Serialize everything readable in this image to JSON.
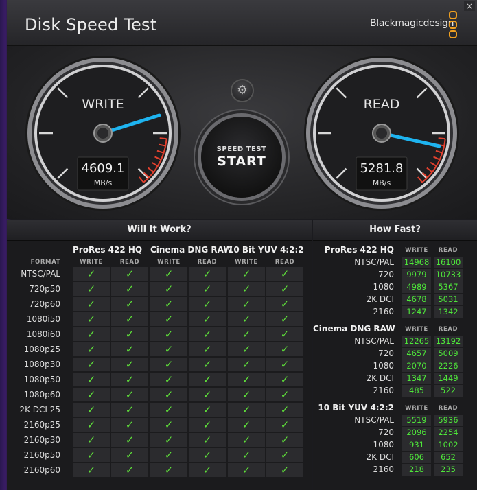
{
  "window": {
    "title": "Disk Speed Test",
    "brand": "Blackmagicdesign",
    "close_glyph": "×"
  },
  "gauges": {
    "write": {
      "label": "WRITE",
      "value": "4609.1",
      "unit": "MB/s",
      "needle_value": 4609.1
    },
    "read": {
      "label": "READ",
      "value": "5281.8",
      "unit": "MB/s",
      "needle_value": 5281.8
    }
  },
  "controls": {
    "settings_icon": "gear-icon",
    "start_sub": "SPEED TEST",
    "start_main": "START"
  },
  "will_it_work": {
    "title": "Will It Work?",
    "format_header": "FORMAT",
    "groups": [
      {
        "name": "ProRes 422 HQ",
        "cols": [
          "WRITE",
          "READ"
        ]
      },
      {
        "name": "Cinema DNG RAW",
        "cols": [
          "WRITE",
          "READ"
        ]
      },
      {
        "name": "10 Bit YUV 4:2:2",
        "cols": [
          "WRITE",
          "READ"
        ]
      }
    ],
    "check_glyph": "✓",
    "rows": [
      {
        "format": "NTSC/PAL",
        "checks": [
          true,
          true,
          true,
          true,
          true,
          true
        ]
      },
      {
        "format": "720p50",
        "checks": [
          true,
          true,
          true,
          true,
          true,
          true
        ]
      },
      {
        "format": "720p60",
        "checks": [
          true,
          true,
          true,
          true,
          true,
          true
        ]
      },
      {
        "format": "1080i50",
        "checks": [
          true,
          true,
          true,
          true,
          true,
          true
        ]
      },
      {
        "format": "1080i60",
        "checks": [
          true,
          true,
          true,
          true,
          true,
          true
        ]
      },
      {
        "format": "1080p25",
        "checks": [
          true,
          true,
          true,
          true,
          true,
          true
        ]
      },
      {
        "format": "1080p30",
        "checks": [
          true,
          true,
          true,
          true,
          true,
          true
        ]
      },
      {
        "format": "1080p50",
        "checks": [
          true,
          true,
          true,
          true,
          true,
          true
        ]
      },
      {
        "format": "1080p60",
        "checks": [
          true,
          true,
          true,
          true,
          true,
          true
        ]
      },
      {
        "format": "2K DCI 25",
        "checks": [
          true,
          true,
          true,
          true,
          true,
          true
        ]
      },
      {
        "format": "2160p25",
        "checks": [
          true,
          true,
          true,
          true,
          true,
          true
        ]
      },
      {
        "format": "2160p30",
        "checks": [
          true,
          true,
          true,
          true,
          true,
          true
        ]
      },
      {
        "format": "2160p50",
        "checks": [
          true,
          true,
          true,
          true,
          true,
          true
        ]
      },
      {
        "format": "2160p60",
        "checks": [
          true,
          true,
          true,
          true,
          true,
          true
        ]
      }
    ]
  },
  "how_fast": {
    "title": "How Fast?",
    "col_write": "WRITE",
    "col_read": "READ",
    "groups": [
      {
        "name": "ProRes 422 HQ",
        "rows": [
          {
            "format": "NTSC/PAL",
            "write": "14968",
            "read": "16100"
          },
          {
            "format": "720",
            "write": "9979",
            "read": "10733"
          },
          {
            "format": "1080",
            "write": "4989",
            "read": "5367"
          },
          {
            "format": "2K DCI",
            "write": "4678",
            "read": "5031"
          },
          {
            "format": "2160",
            "write": "1247",
            "read": "1342"
          }
        ]
      },
      {
        "name": "Cinema DNG RAW",
        "rows": [
          {
            "format": "NTSC/PAL",
            "write": "12265",
            "read": "13192"
          },
          {
            "format": "720",
            "write": "4657",
            "read": "5009"
          },
          {
            "format": "1080",
            "write": "2070",
            "read": "2226"
          },
          {
            "format": "2K DCI",
            "write": "1347",
            "read": "1449"
          },
          {
            "format": "2160",
            "write": "485",
            "read": "522"
          }
        ]
      },
      {
        "name": "10 Bit YUV 4:2:2",
        "rows": [
          {
            "format": "NTSC/PAL",
            "write": "5519",
            "read": "5936"
          },
          {
            "format": "720",
            "write": "2096",
            "read": "2254"
          },
          {
            "format": "1080",
            "write": "931",
            "read": "1002"
          },
          {
            "format": "2K DCI",
            "write": "606",
            "read": "652"
          },
          {
            "format": "2160",
            "write": "218",
            "read": "235"
          }
        ]
      }
    ]
  },
  "colors": {
    "needle": "#1eb4f0",
    "check": "#5fe23a",
    "value": "#4ee63a",
    "redline": "#e2412f",
    "logo_orange": "#f0a020"
  }
}
